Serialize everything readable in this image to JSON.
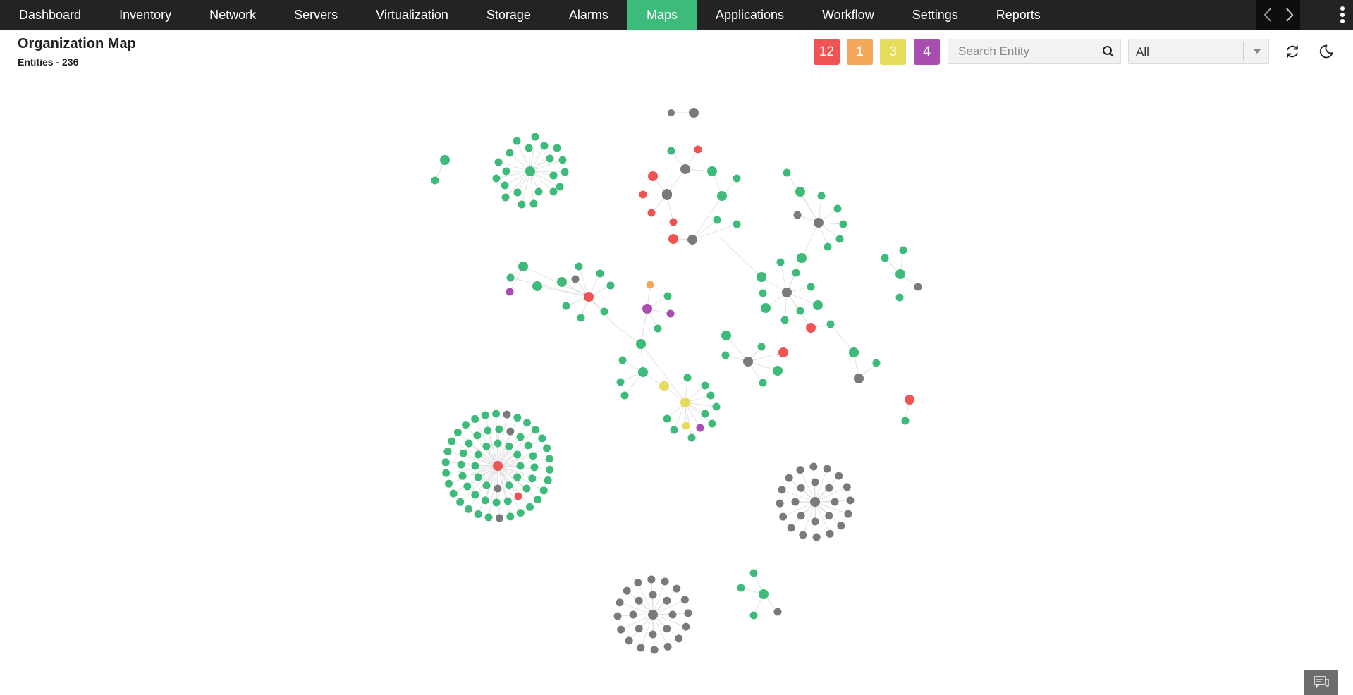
{
  "nav": {
    "items": [
      {
        "label": "Dashboard",
        "name": "nav-dashboard"
      },
      {
        "label": "Inventory",
        "name": "nav-inventory"
      },
      {
        "label": "Network",
        "name": "nav-network"
      },
      {
        "label": "Servers",
        "name": "nav-servers"
      },
      {
        "label": "Virtualization",
        "name": "nav-virtualization"
      },
      {
        "label": "Storage",
        "name": "nav-storage"
      },
      {
        "label": "Alarms",
        "name": "nav-alarms"
      },
      {
        "label": "Maps",
        "name": "nav-maps",
        "active": true
      },
      {
        "label": "Applications",
        "name": "nav-applications"
      },
      {
        "label": "Workflow",
        "name": "nav-workflow"
      },
      {
        "label": "Settings",
        "name": "nav-settings"
      },
      {
        "label": "Reports",
        "name": "nav-reports"
      }
    ],
    "active_color": "#3dbb7b",
    "background": "#232323"
  },
  "header": {
    "title": "Organization Map",
    "entities": "Entities - 236"
  },
  "severity_badges": [
    {
      "count": "12",
      "color": "#f05353",
      "name": "critical-count-badge"
    },
    {
      "count": "1",
      "color": "#f5a85a",
      "name": "trouble-count-badge"
    },
    {
      "count": "3",
      "color": "#e6dc5c",
      "name": "attention-count-badge"
    },
    {
      "count": "4",
      "color": "#a94eb0",
      "name": "service-down-count-badge"
    }
  ],
  "search": {
    "placeholder": "Search Entity",
    "value": ""
  },
  "filter": {
    "selected": "All"
  },
  "icons": {
    "search": "search-icon",
    "dropdown": "chevron-down-icon",
    "refresh": "refresh-icon",
    "theme": "moon-icon",
    "prev": "chevron-left-icon",
    "next": "chevron-right-icon",
    "menu": "kebab-menu-icon",
    "chat": "chat-icon"
  },
  "status_colors": {
    "clear": "#3dbb7b",
    "unknown": "#7a7a7a",
    "critical": "#f05353",
    "trouble": "#f5a85a",
    "attention": "#e6dc5c",
    "service_down": "#a94eb0"
  }
}
